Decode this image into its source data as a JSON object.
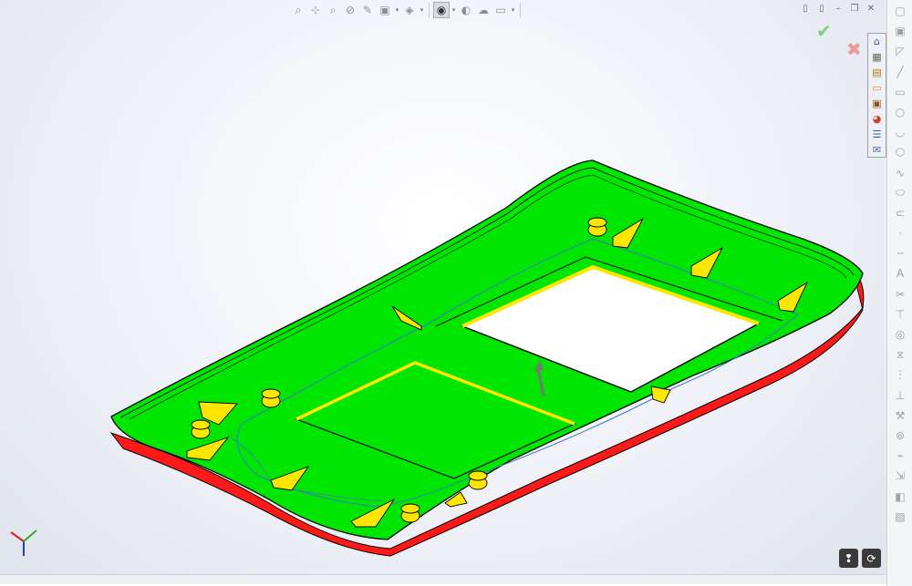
{
  "heads_up_toolbar": {
    "buttons": [
      {
        "icon": "zoom-to-fit-icon",
        "glyph": "⌕"
      },
      {
        "icon": "zoom-to-area-icon",
        "glyph": "⊹"
      },
      {
        "icon": "previous-view-icon",
        "glyph": "⌕"
      },
      {
        "icon": "section-view-icon",
        "glyph": "⊘"
      },
      {
        "icon": "dynamic-annotation-icon",
        "glyph": "✎"
      },
      {
        "icon": "view-orientation-icon",
        "glyph": "▣"
      },
      {
        "icon": "display-style-icon",
        "glyph": "◈"
      },
      {
        "icon": "hide-show-items-icon",
        "glyph": "◉"
      },
      {
        "icon": "edit-appearance-icon",
        "glyph": "◐"
      },
      {
        "icon": "apply-scene-icon",
        "glyph": "☁"
      },
      {
        "icon": "view-settings-icon",
        "glyph": "▭"
      }
    ]
  },
  "window_controls": {
    "buttons": [
      {
        "icon": "split-view-icon",
        "glyph": "▯"
      },
      {
        "icon": "restore-view-icon",
        "glyph": "▯"
      },
      {
        "icon": "minimize-icon",
        "glyph": "–"
      },
      {
        "icon": "maximize-icon",
        "glyph": "❐"
      },
      {
        "icon": "close-icon",
        "glyph": "✕"
      }
    ]
  },
  "confirmation_corner": {
    "ok_glyph": "✔",
    "cancel_glyph": "✖"
  },
  "task_pane": {
    "tabs": [
      {
        "icon": "home-icon",
        "glyph": "⌂"
      },
      {
        "icon": "resources-icon",
        "glyph": "▦"
      },
      {
        "icon": "design-library-icon",
        "glyph": "▤"
      },
      {
        "icon": "file-explorer-icon",
        "glyph": "▭"
      },
      {
        "icon": "view-palette-icon",
        "glyph": "▣"
      },
      {
        "icon": "appearances-icon",
        "glyph": "◕"
      },
      {
        "icon": "custom-properties-icon",
        "glyph": "☰"
      },
      {
        "icon": "forum-icon",
        "glyph": "✉"
      }
    ]
  },
  "command_strip": {
    "buttons": [
      {
        "icon": "sketch-icon",
        "glyph": "▢"
      },
      {
        "icon": "3d-sketch-icon",
        "glyph": "▣"
      },
      {
        "icon": "smart-dimension-icon",
        "glyph": "◸"
      },
      {
        "icon": "line-icon",
        "glyph": "╱"
      },
      {
        "icon": "rectangle-icon",
        "glyph": "▭"
      },
      {
        "icon": "circle-icon",
        "glyph": "○"
      },
      {
        "icon": "arc-icon",
        "glyph": "◡"
      },
      {
        "icon": "polygon-icon",
        "glyph": "⬡"
      },
      {
        "icon": "spline-icon",
        "glyph": "∿"
      },
      {
        "icon": "ellipse-icon",
        "glyph": "⬭"
      },
      {
        "icon": "slot-icon",
        "glyph": "⊂"
      },
      {
        "icon": "point-icon",
        "glyph": "·"
      },
      {
        "icon": "centerline-icon",
        "glyph": "╌"
      },
      {
        "icon": "text-icon",
        "glyph": "A"
      },
      {
        "icon": "trim-icon",
        "glyph": "✂"
      },
      {
        "icon": "extend-icon",
        "glyph": "⊤"
      },
      {
        "icon": "offset-icon",
        "glyph": "◎"
      },
      {
        "icon": "mirror-icon",
        "glyph": "⧖"
      },
      {
        "icon": "pattern-icon",
        "glyph": "⋮"
      },
      {
        "icon": "relations-icon",
        "glyph": "⊥"
      },
      {
        "icon": "repair-sketch-icon",
        "glyph": "⚒"
      },
      {
        "icon": "quick-snaps-icon",
        "glyph": "⊚"
      },
      {
        "icon": "rapid-sketch-icon",
        "glyph": "⌁"
      },
      {
        "icon": "instant-2d-icon",
        "glyph": "⇲"
      },
      {
        "icon": "shaded-contours-icon",
        "glyph": "◧"
      },
      {
        "icon": "sketch-picture-icon",
        "glyph": "▨"
      }
    ]
  },
  "triad": {
    "x_axis_color": "#d22222",
    "y_axis_color": "#2faa2f",
    "z_axis_color": "#2a3fb8"
  },
  "bottom_right_tools": {
    "buttons": [
      {
        "icon": "bubble-icon",
        "glyph": "❢"
      },
      {
        "icon": "rotate-icon",
        "glyph": "⟳"
      }
    ]
  },
  "model": {
    "top_face_color": "#00e600",
    "side_wall_color": "#ff1a1a",
    "feature_color": "#ffe600",
    "edge_color": "#000000",
    "sketch_color": "#3c78c8",
    "background_color": "#eef0f5"
  }
}
